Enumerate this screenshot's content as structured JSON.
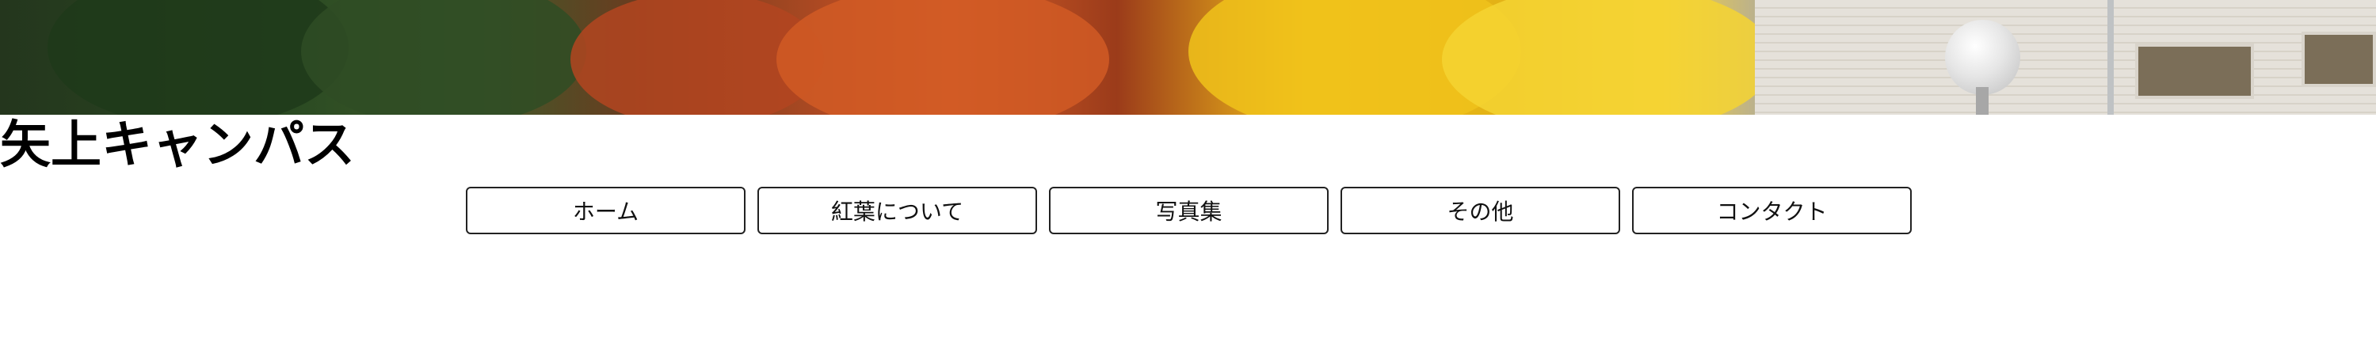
{
  "banner": {
    "description_icon": "autumn-foliage-photo"
  },
  "header": {
    "title": "矢上キャンパス"
  },
  "nav": {
    "items": [
      {
        "label": "ホーム"
      },
      {
        "label": "紅葉について"
      },
      {
        "label": "写真集"
      },
      {
        "label": "その他"
      },
      {
        "label": "コンタクト"
      }
    ]
  },
  "colors": {
    "text": "#000000",
    "button_border": "#222222",
    "background": "#ffffff"
  }
}
